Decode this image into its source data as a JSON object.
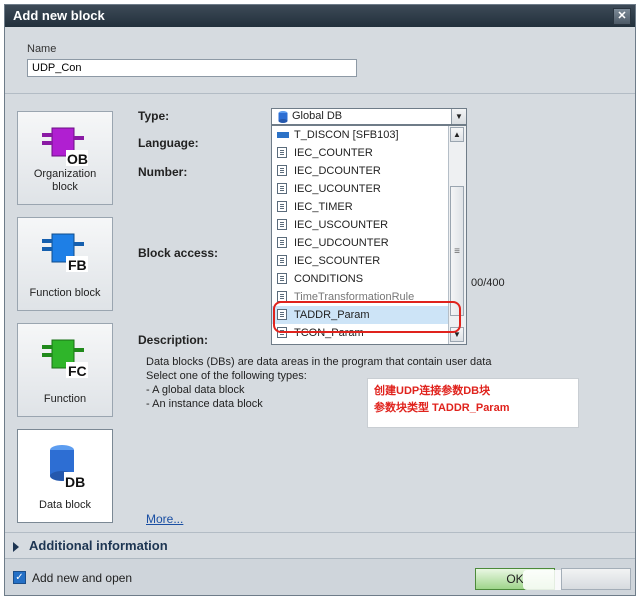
{
  "window": {
    "title": "Add new block",
    "close_glyph": "✕"
  },
  "name": {
    "label": "Name",
    "value": "UDP_Con"
  },
  "block_types": [
    {
      "caption_line1": "Organization",
      "caption_line2": "block",
      "tag": "OB",
      "color": "#b01fd1",
      "icon": "organization-block-icon"
    },
    {
      "caption_line1": "Function block",
      "caption_line2": "",
      "tag": "FB",
      "color": "#1e7fe6",
      "icon": "function-block-icon"
    },
    {
      "caption_line1": "Function",
      "caption_line2": "",
      "tag": "FC",
      "color": "#2fb52a",
      "icon": "function-icon"
    },
    {
      "caption_line1": "Data block",
      "caption_line2": "",
      "tag": "DB",
      "color": "#2d6ed3",
      "icon": "data-block-icon",
      "active": true
    }
  ],
  "fields": {
    "type_label": "Type:",
    "language_label": "Language:",
    "number_label": "Number:",
    "block_access_label": "Block access:",
    "description_label": "Description:"
  },
  "type_select": {
    "value": "Global DB",
    "arrow": "▼"
  },
  "dropdown": {
    "items": [
      "T_DISCON [SFB103]",
      "IEC_COUNTER",
      "IEC_DCOUNTER",
      "IEC_UCOUNTER",
      "IEC_TIMER",
      "IEC_USCOUNTER",
      "IEC_UDCOUNTER",
      "IEC_SCOUNTER",
      "CONDITIONS",
      "TimeTransformationRule",
      "TADDR_Param",
      "TCON_Param"
    ],
    "selected_index": 10,
    "scroll_up": "▲",
    "scroll_down": "▼",
    "thumb_grip": "≡"
  },
  "number_fragment": "00/400",
  "description": {
    "line1": "Data blocks (DBs) are data areas in the program that contain user data",
    "line2": "Select one of the following types:",
    "line3": "- A global data block",
    "line4": "- An instance data block"
  },
  "annotation": {
    "line1": "创建UDP连接参数DB块",
    "line2": "参数块类型  TADDR_Param"
  },
  "more_link": "More...",
  "additional_information": "Additional information",
  "footer": {
    "add_new_and_open": "Add new and open",
    "checkbox_checked": true,
    "check_glyph": "✓",
    "ok_label": "OK"
  },
  "colors": {
    "title_bar": "#2b3845",
    "selection": "#cde4f7",
    "annotation_red": "#e0231d",
    "link": "#1a4fa3"
  }
}
